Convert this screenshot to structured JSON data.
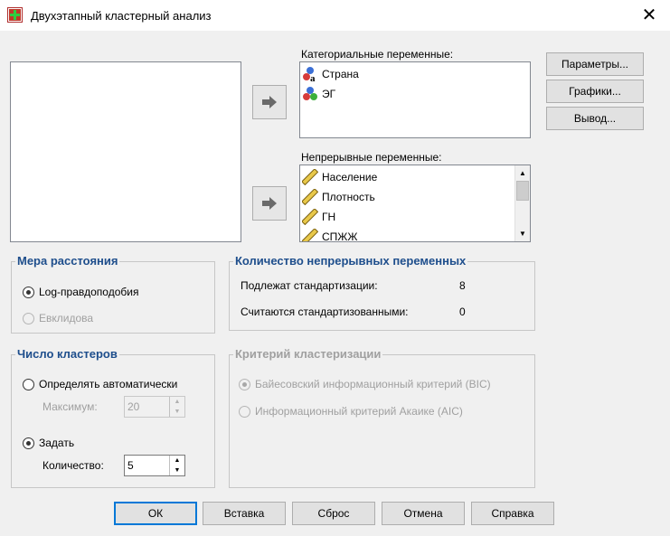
{
  "window": {
    "title": "Двухэтапный кластерный анализ",
    "close_glyph": "✕"
  },
  "categorical": {
    "label": "Категориальные переменные:",
    "items": [
      {
        "name": "Страна",
        "icon": "nominal-variable-icon"
      },
      {
        "name": "ЭГ",
        "icon": "nominal-variable-icon"
      }
    ]
  },
  "continuous": {
    "label": "Непрерывные переменные:",
    "items": [
      {
        "name": "Население",
        "icon": "scale-variable-icon"
      },
      {
        "name": "Плотность",
        "icon": "scale-variable-icon"
      },
      {
        "name": "ГН",
        "icon": "scale-variable-icon"
      },
      {
        "name": "СПЖЖ",
        "icon": "scale-variable-icon"
      }
    ]
  },
  "side_buttons": {
    "params": "Параметры...",
    "charts": "Графики...",
    "output": "Вывод..."
  },
  "distance": {
    "title": "Мера расстояния",
    "loglik": "Log-правдоподобия",
    "euclid": "Евклидова"
  },
  "count_cont": {
    "title": "Количество непрерывных переменных",
    "row1_label": "Подлежат стандартизации:",
    "row1_value": "8",
    "row2_label": "Считаются стандартизованными:",
    "row2_value": "0"
  },
  "clusters": {
    "title": "Число кластеров",
    "auto": "Определять автоматически",
    "max_label": "Максимум:",
    "max_value": "20",
    "fixed": "Задать",
    "count_label": "Количество:",
    "count_value": "5"
  },
  "criterion": {
    "title": "Критерий кластеризации",
    "bic": "Байесовский информационный критерий (BIC)",
    "aic": "Информационный критерий Акаике (AIC)"
  },
  "bottom_buttons": {
    "ok": "ОК",
    "paste": "Вставка",
    "reset": "Сброс",
    "cancel": "Отмена",
    "help": "Справка"
  },
  "colors": {
    "group_title": "#1e4e8c",
    "default_button_border": "#0078d7"
  }
}
